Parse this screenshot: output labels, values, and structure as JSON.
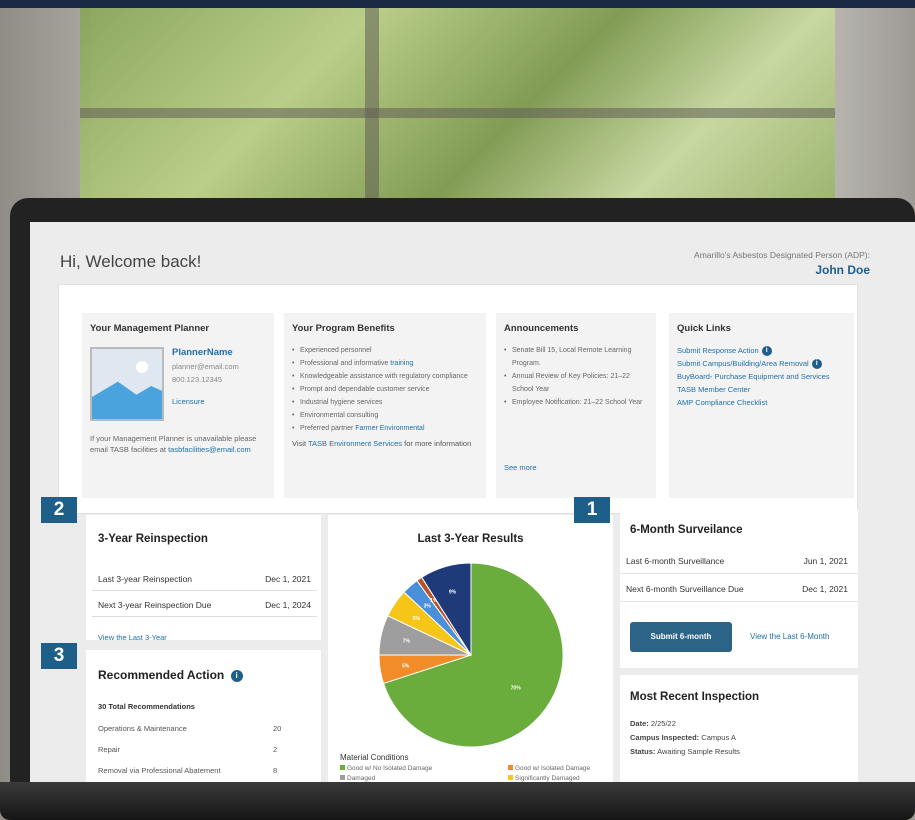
{
  "header": {
    "greeting": "Hi, Welcome back!",
    "adp_label": "Amarillo's Asbestos Designated Person (ADP):",
    "adp_name": "John Doe"
  },
  "planner": {
    "title": "Your Management Planner",
    "name": "PlannerName",
    "email": "planner@email.com",
    "phone": "800.123.12345",
    "licensure": "Licensure",
    "note": "If your Management Planner is unavailable please email TASB facilities at",
    "note_email": "tasbfacilities@email.com"
  },
  "benefits": {
    "title": "Your Program Benefits",
    "items": [
      {
        "text": "Experienced personnel",
        "link": ""
      },
      {
        "text": "Professional and informative ",
        "link": "training"
      },
      {
        "text": "Knowledgeable assistance with regulatory compliance",
        "link": ""
      },
      {
        "text": "Prompt and dependable customer service",
        "link": ""
      },
      {
        "text": "Industrial hygiene services",
        "link": ""
      },
      {
        "text": "Environmental consulting",
        "link": ""
      },
      {
        "text": "Preferred partner ",
        "link": "Farmer Environmental"
      }
    ],
    "visit_pre": "Visit ",
    "visit_link": "TASB Environment Services",
    "visit_post": " for more information"
  },
  "announcements": {
    "title": "Announcements",
    "items": [
      "Senate Bill 15, Local Remote Learning Program.",
      "Annual Review of Key Policies: 21–22 School Year",
      "Employee Notification: 21–22 School Year"
    ],
    "see_more": "See more"
  },
  "quick_links": {
    "title": "Quick Links",
    "items": [
      "Submit Response Action",
      "Submit Campus/Building/Area Removal",
      "BuyBoard- Purchase Equipment and Services",
      "TASB Member Center",
      "AMP Compliance Checklist"
    ],
    "info_icon": "i"
  },
  "reinspection": {
    "title": "3-Year Reinspection",
    "rows": [
      {
        "label": "Last 3-year Reinspection",
        "value": "Dec 1, 2021"
      },
      {
        "label": "Next 3-year Reinspection Due",
        "value": "Dec 1, 2024"
      }
    ],
    "view_link": "View the Last 3-Year"
  },
  "recommended": {
    "title": "Recommended Action",
    "info_icon": "i",
    "total": "30 Total Recommendations",
    "rows": [
      {
        "label": "Operations & Maintenance",
        "value": "20"
      },
      {
        "label": "Repair",
        "value": "2"
      },
      {
        "label": "Removal via Professional Abatement",
        "value": "8"
      }
    ]
  },
  "results": {
    "title": "Last 3-Year Results",
    "legend_title": "Material Conditions",
    "legend": [
      {
        "label": "Good w/ No Isolated Damage",
        "color": "#6aad3d"
      },
      {
        "label": "Good w/ Isolated Damage",
        "color": "#f28c28"
      },
      {
        "label": "Damaged",
        "color": "#9e9e9e"
      },
      {
        "label": "Significantly Damaged",
        "color": "#f5c518"
      }
    ]
  },
  "surveillance": {
    "title": "6-Month Surveilance",
    "rows": [
      {
        "label": "Last 6-month Surveillance",
        "value": "Jun 1, 2021"
      },
      {
        "label": "Next 6-month Surveillance Due",
        "value": "Dec 1, 2021"
      }
    ],
    "submit_label": "Submit 6-month",
    "view_link": "View the Last 6-Month"
  },
  "inspection": {
    "title": "Most Recent Inspection",
    "date_label": "Date:",
    "date": "2/25/22",
    "campus_label": "Campus Inspected:",
    "campus": "Campus A",
    "status_label": "Status:",
    "status": "Awaiting Sample Results"
  },
  "badges": [
    "1",
    "2",
    "3"
  ],
  "chart_data": {
    "type": "pie",
    "title": "Last 3-Year Results",
    "slices": [
      {
        "label": "",
        "value": 70,
        "color": "#6aad3d"
      },
      {
        "label": "",
        "value": 5,
        "color": "#f28c28"
      },
      {
        "label": "",
        "value": 7,
        "color": "#9e9e9e"
      },
      {
        "label": "",
        "value": 5,
        "color": "#f5c518"
      },
      {
        "label": "",
        "value": 3,
        "color": "#4a90d9"
      },
      {
        "label": "",
        "value": 1,
        "color": "#b5532a"
      },
      {
        "label": "",
        "value": 9,
        "color": "#1e3a78"
      }
    ],
    "data_labels": [
      "70%",
      "5%",
      "7%",
      "5%",
      "3%",
      "1%",
      "9%"
    ]
  }
}
